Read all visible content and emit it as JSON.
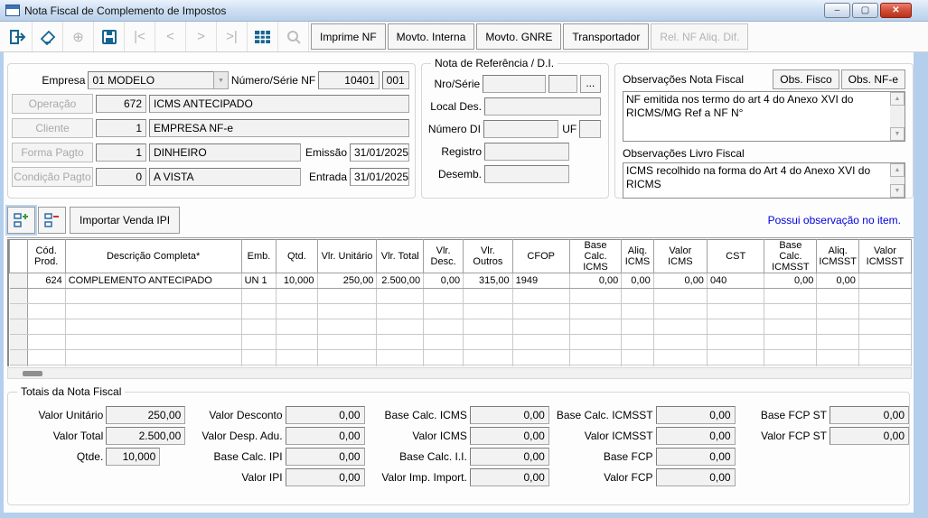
{
  "window": {
    "title": "Nota Fiscal de Complemento de Impostos",
    "minimize_glyph": "–",
    "maximize_glyph": "▢",
    "close_glyph": "✕"
  },
  "toolbar": {
    "icons": {
      "add_record": "⊕",
      "nav_first": "|<",
      "nav_prev": "<",
      "nav_next": ">",
      "nav_last": ">|"
    },
    "buttons": [
      "Imprime NF",
      "Movto. Interna",
      "Movto. GNRE",
      "Transportador",
      "Rel. NF Aliq. Dif."
    ]
  },
  "form": {
    "empresa_label": "Empresa",
    "empresa_value": "01 MODELO",
    "dropdown_arrow": "▼",
    "numero_serie_label": "Número/Série NF",
    "numero_value": "10401",
    "serie_value": "001",
    "rows": [
      {
        "button": "Operação",
        "code": "672",
        "desc": "ICMS ANTECIPADO"
      },
      {
        "button": "Cliente",
        "code": "1",
        "desc": "EMPRESA NF-e"
      },
      {
        "button": "Forma Pagto",
        "code": "1",
        "desc": "DINHEIRO",
        "date_label": "Emissão",
        "date": "31/01/2025"
      },
      {
        "button": "Condição Pagto",
        "code": "0",
        "desc": "A VISTA",
        "date_label": "Entrada",
        "date": "31/01/2025"
      }
    ]
  },
  "ref_group": {
    "title": "Nota de Referência / D.I.",
    "nro_serie_label": "Nro/Série",
    "browse_label": "...",
    "local_des_label": "Local Des.",
    "numero_di_label": "Número DI",
    "uf_label": "UF",
    "registro_label": "Registro",
    "desemb_label": "Desemb."
  },
  "obs_group": {
    "nf_label": "Observações Nota Fiscal",
    "fisco_btn": "Obs. Fisco",
    "nfe_btn": "Obs. NF-e",
    "nf_text": "NF emitida nos termo do art 4 do Anexo XVI do RICMS/MG Ref a NF N°",
    "livro_label": "Observações Livro Fiscal",
    "livro_text": "ICMS recolhido na forma do Art 4 do Anexo XVI do RICMS",
    "scroll_up": "▲",
    "scroll_down": "▼"
  },
  "items_bar": {
    "import_btn": "Importar Venda IPI",
    "note": "Possui observação no item."
  },
  "grid": {
    "columns": [
      "",
      "Cód.\nProd.",
      "Descrição Completa*",
      "Emb.",
      "Qtd.",
      "Vlr. Unitário",
      "Vlr. Total",
      "Vlr. Desc.",
      "Vlr. Outros",
      "CFOP",
      "Base Calc.\nICMS",
      "Aliq.\nICMS",
      "Valor ICMS",
      "CST",
      "Base Calc.\nICMSST",
      "Aliq.\nICMSST",
      "Valor ICMSST"
    ],
    "item_row": [
      "",
      "624",
      "COMPLEMENTO ANTECIPADO",
      "UN 1",
      "10,000",
      "250,00",
      "2.500,00",
      "0,00",
      "315,00",
      "1949",
      "0,00",
      "0,00",
      "0,00",
      "040",
      "0,00",
      "0,00",
      ""
    ]
  },
  "totals": {
    "title": "Totais da Nota Fiscal",
    "col1": [
      {
        "label": "Valor Unitário",
        "value": "250,00"
      },
      {
        "label": "Valor Total",
        "value": "2.500,00"
      },
      {
        "label": "Qtde.",
        "value": "10,000"
      }
    ],
    "col2": [
      {
        "label": "Valor Desconto",
        "value": "0,00"
      },
      {
        "label": "Valor Desp. Adu.",
        "value": "0,00"
      },
      {
        "label": "Base Calc. IPI",
        "value": "0,00"
      },
      {
        "label": "Valor IPI",
        "value": "0,00"
      }
    ],
    "col3": [
      {
        "label": "Base Calc. ICMS",
        "value": "0,00"
      },
      {
        "label": "Valor ICMS",
        "value": "0,00"
      },
      {
        "label": "Base Calc. I.I.",
        "value": "0,00"
      },
      {
        "label": "Valor Imp. Import.",
        "value": "0,00"
      }
    ],
    "col4": [
      {
        "label": "Base Calc. ICMSST",
        "value": "0,00"
      },
      {
        "label": "Valor ICMSST",
        "value": "0,00"
      },
      {
        "label": "Base FCP",
        "value": "0,00"
      },
      {
        "label": "Valor FCP",
        "value": "0,00"
      }
    ],
    "col5": [
      {
        "label": "Base FCP ST",
        "value": "0,00"
      },
      {
        "label": "Valor FCP ST",
        "value": "0,00"
      }
    ]
  }
}
